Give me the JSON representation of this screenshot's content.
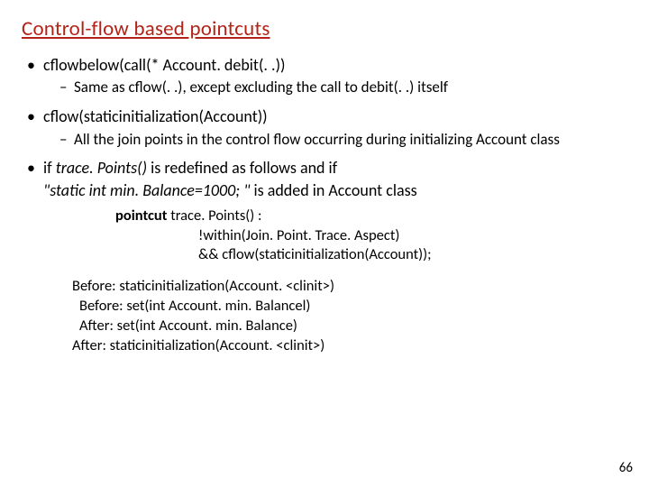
{
  "title": "Control-flow based pointcuts",
  "b1": {
    "head": "cflowbelow(call(* Account. debit(. .))",
    "sub": "Same as cflow(. .), except excluding the call to debit(. .) itself"
  },
  "b2": {
    "head": "cflow(staticinitialization(Account))",
    "sub": "All the join points in the control flow occurring during initializing Account class"
  },
  "b3": {
    "line1_a": "if ",
    "line1_i": "trace. Points()",
    "line1_b": " is redefined as follows and if",
    "line2_a": "\"static int min. Balance=1000; \"",
    "line2_b": " is added in Account class"
  },
  "code": {
    "kw": "pointcut",
    "l1_rest": " trace. Points() :",
    "l2": "!within(Join. Point. Trace. Aspect)",
    "l3": "&& cflow(staticinitialization(Account));"
  },
  "out": {
    "l1": "Before: staticinitialization(Account. <clinit>)",
    "l2": "Before: set(int Account. min. Balancel)",
    "l3": "After: set(int Account. min. Balance)",
    "l4": "After: staticinitialization(Account. <clinit>)"
  },
  "page": "66"
}
